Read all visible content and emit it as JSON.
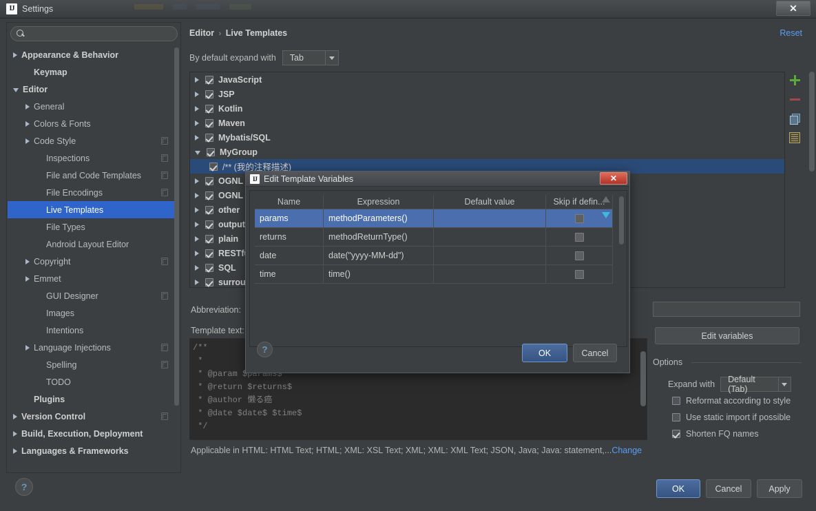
{
  "window": {
    "title": "Settings",
    "app_icon": "IJ",
    "close_label": "✕"
  },
  "sidebar": {
    "search": {
      "value": "",
      "placeholder": "",
      "icon": "search-icon"
    },
    "items": [
      {
        "label": "Appearance & Behavior",
        "arrow": "right",
        "bold": true,
        "indent": 0,
        "copy": false
      },
      {
        "label": "Keymap",
        "arrow": "none",
        "bold": true,
        "indent": 1,
        "copy": false
      },
      {
        "label": "Editor",
        "arrow": "down",
        "bold": true,
        "indent": 0,
        "copy": false
      },
      {
        "label": "General",
        "arrow": "right",
        "bold": false,
        "indent": 1,
        "copy": false
      },
      {
        "label": "Colors & Fonts",
        "arrow": "right",
        "bold": false,
        "indent": 1,
        "copy": false
      },
      {
        "label": "Code Style",
        "arrow": "right",
        "bold": false,
        "indent": 1,
        "copy": true
      },
      {
        "label": "Inspections",
        "arrow": "none",
        "bold": false,
        "indent": 2,
        "copy": true
      },
      {
        "label": "File and Code Templates",
        "arrow": "none",
        "bold": false,
        "indent": 2,
        "copy": true
      },
      {
        "label": "File Encodings",
        "arrow": "none",
        "bold": false,
        "indent": 2,
        "copy": true
      },
      {
        "label": "Live Templates",
        "arrow": "none",
        "bold": false,
        "indent": 2,
        "copy": false,
        "selected": true
      },
      {
        "label": "File Types",
        "arrow": "none",
        "bold": false,
        "indent": 2,
        "copy": false
      },
      {
        "label": "Android Layout Editor",
        "arrow": "none",
        "bold": false,
        "indent": 2,
        "copy": false
      },
      {
        "label": "Copyright",
        "arrow": "right",
        "bold": false,
        "indent": 1,
        "copy": true
      },
      {
        "label": "Emmet",
        "arrow": "right",
        "bold": false,
        "indent": 1,
        "copy": false
      },
      {
        "label": "GUI Designer",
        "arrow": "none",
        "bold": false,
        "indent": 2,
        "copy": true
      },
      {
        "label": "Images",
        "arrow": "none",
        "bold": false,
        "indent": 2,
        "copy": false
      },
      {
        "label": "Intentions",
        "arrow": "none",
        "bold": false,
        "indent": 2,
        "copy": false
      },
      {
        "label": "Language Injections",
        "arrow": "right",
        "bold": false,
        "indent": 1,
        "copy": true
      },
      {
        "label": "Spelling",
        "arrow": "none",
        "bold": false,
        "indent": 2,
        "copy": true
      },
      {
        "label": "TODO",
        "arrow": "none",
        "bold": false,
        "indent": 2,
        "copy": false
      },
      {
        "label": "Plugins",
        "arrow": "none",
        "bold": true,
        "indent": 1,
        "copy": false
      },
      {
        "label": "Version Control",
        "arrow": "right",
        "bold": true,
        "indent": 0,
        "copy": true
      },
      {
        "label": "Build, Execution, Deployment",
        "arrow": "right",
        "bold": true,
        "indent": 0,
        "copy": false
      },
      {
        "label": "Languages & Frameworks",
        "arrow": "right",
        "bold": true,
        "indent": 0,
        "copy": false
      }
    ],
    "help_label": "?"
  },
  "main": {
    "breadcrumb": {
      "root": "Editor",
      "separator": "›",
      "leaf": "Live Templates"
    },
    "reset_label": "Reset",
    "expand_with": {
      "label": "By default expand with",
      "value": "Tab"
    },
    "template_tree": [
      {
        "label": "JavaScript",
        "checked": true,
        "arrow": "right",
        "leaf": false
      },
      {
        "label": "JSP",
        "checked": true,
        "arrow": "right",
        "leaf": false
      },
      {
        "label": "Kotlin",
        "checked": true,
        "arrow": "right",
        "leaf": false
      },
      {
        "label": "Maven",
        "checked": true,
        "arrow": "right",
        "leaf": false
      },
      {
        "label": "Mybatis/SQL",
        "checked": true,
        "arrow": "right",
        "leaf": false
      },
      {
        "label": "MyGroup",
        "checked": true,
        "arrow": "down",
        "leaf": false
      },
      {
        "label": "/** (我的注释描述)",
        "checked": true,
        "arrow": "none",
        "leaf": true,
        "selected": true
      },
      {
        "label": "OGNL",
        "checked": true,
        "arrow": "right",
        "leaf": false
      },
      {
        "label": "OGNL",
        "checked": true,
        "arrow": "right",
        "leaf": false
      },
      {
        "label": "other",
        "checked": true,
        "arrow": "right",
        "leaf": false
      },
      {
        "label": "output",
        "checked": true,
        "arrow": "right",
        "leaf": false
      },
      {
        "label": "plain",
        "checked": true,
        "arrow": "right",
        "leaf": false
      },
      {
        "label": "RESTful",
        "checked": true,
        "arrow": "right",
        "leaf": false
      },
      {
        "label": "SQL",
        "checked": true,
        "arrow": "right",
        "leaf": false
      },
      {
        "label": "surround",
        "checked": true,
        "arrow": "right",
        "leaf": false
      }
    ],
    "list_tools": [
      {
        "name": "add-icon",
        "label": "+"
      },
      {
        "name": "remove-icon",
        "label": "−"
      },
      {
        "name": "copy-icon",
        "label": "copy"
      },
      {
        "name": "duplicate-icon",
        "label": "list"
      }
    ],
    "abbreviation_label": "Abbreviation:",
    "abbreviation_value": "",
    "template_text_label": "Template text:",
    "template_code": [
      "/**",
      " *",
      " * @param $params$",
      " * @return $returns$",
      " * @author 懒る癌",
      " * @date $date$ $time$",
      " */"
    ],
    "applicable_text": "Applicable in HTML: HTML Text; HTML; XML: XSL Text; XML; XML: XML Text; JSON, Java; Java: statement,...",
    "applicable_change": "Change"
  },
  "options": {
    "edit_variables_label": "Edit variables",
    "group_label": "Options",
    "expand_with_label": "Expand with",
    "expand_with_value": "Default (Tab)",
    "checkboxes": [
      {
        "label": "Reformat according to style",
        "checked": false
      },
      {
        "label": "Use static import if possible",
        "checked": false
      },
      {
        "label": "Shorten FQ names",
        "checked": true
      }
    ]
  },
  "footer": {
    "ok": "OK",
    "cancel": "Cancel",
    "apply": "Apply"
  },
  "modal": {
    "title": "Edit Template Variables",
    "app_icon": "IJ",
    "close_label": "✕",
    "columns": [
      "Name",
      "Expression",
      "Default value",
      "Skip if defin..."
    ],
    "rows": [
      {
        "name": "params",
        "expression": "methodParameters()",
        "default": "",
        "skip": false,
        "selected": true
      },
      {
        "name": "returns",
        "expression": "methodReturnType()",
        "default": "",
        "skip": false,
        "selected": false
      },
      {
        "name": "date",
        "expression": "date(\"yyyy-MM-dd\")",
        "default": "",
        "skip": false,
        "selected": false
      },
      {
        "name": "time",
        "expression": "time()",
        "default": "",
        "skip": false,
        "selected": false
      }
    ],
    "move_up_icon": "arrow-up-icon",
    "move_down_icon": "arrow-down-icon",
    "help_label": "?",
    "ok": "OK",
    "cancel": "Cancel"
  },
  "colors": {
    "background": "#3c3f41",
    "selection_blue": "#2f65ca",
    "table_selection": "#4b6eaf",
    "link": "#589df6",
    "accent_green": "#5aaa3c",
    "accent_red": "#a4474a",
    "code_bg": "#2b2b2b"
  }
}
